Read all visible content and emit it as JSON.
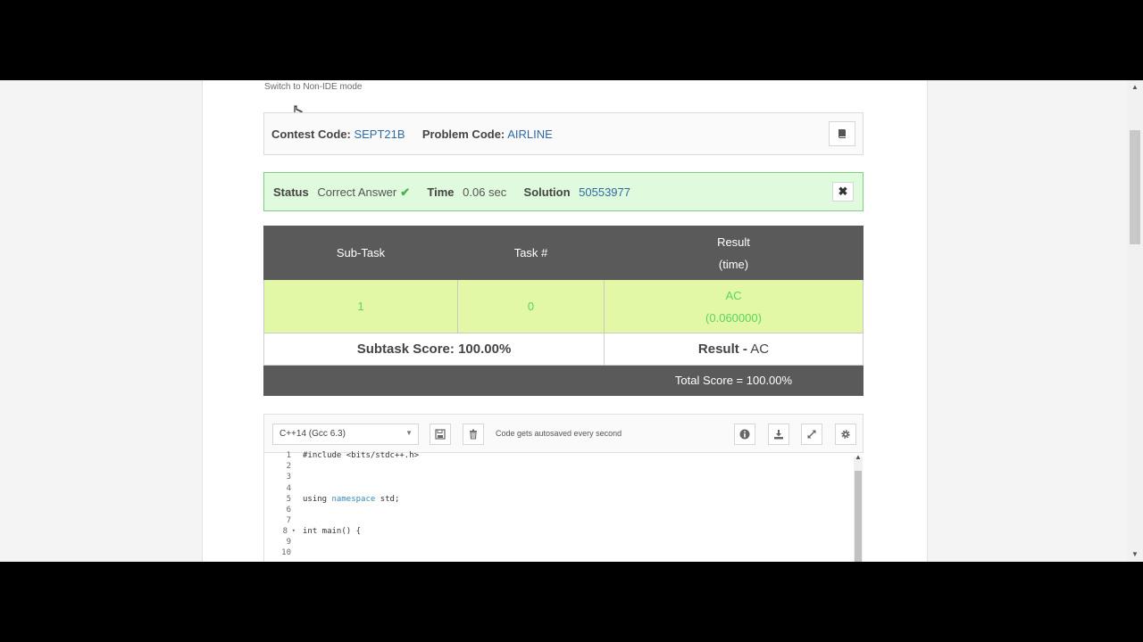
{
  "switch_mode_label": "Switch to Non-IDE mode",
  "contest": {
    "contest_label": "Contest Code:",
    "contest_code": "SEPT21B",
    "problem_label": "Problem Code:",
    "problem_code": "AIRLINE",
    "book_icon": "book-icon"
  },
  "status": {
    "status_label": "Status",
    "status_value": "Correct Answer",
    "check_icon": "✔",
    "time_label": "Time",
    "time_value": "0.06 sec",
    "solution_label": "Solution",
    "solution_id": "50553977",
    "close_icon": "✖"
  },
  "result_table": {
    "headers": {
      "subtask": "Sub-Task",
      "task": "Task #",
      "result_line1": "Result",
      "result_line2": "(time)"
    },
    "rows": [
      {
        "subtask": "1",
        "task": "0",
        "result": "AC",
        "time": "(0.060000)"
      }
    ],
    "subtask_score_label": "Subtask Score:",
    "subtask_score_value": "100.00%",
    "result_label": "Result -",
    "result_value": "AC",
    "total_score": "Total Score = 100.00%"
  },
  "editor": {
    "language": "C++14 (Gcc 6.3)",
    "autosave_text": "Code gets autosaved every second",
    "line_numbers": [
      "1",
      "2",
      "3",
      "4",
      "5",
      "6",
      "7",
      "8",
      "9",
      "10"
    ],
    "lines": {
      "l1": "#include <bits/stdc++.h>",
      "l5_a": "using ",
      "l5_kw": "namespace",
      "l5_b": " std;",
      "l8": "int main() {"
    },
    "fold_marker": "▾"
  },
  "colors": {
    "accent_link": "#2f6aa4",
    "success_bg": "#dffadc",
    "ac_green": "#5cd45c",
    "header_gray": "#5a5a5a"
  }
}
